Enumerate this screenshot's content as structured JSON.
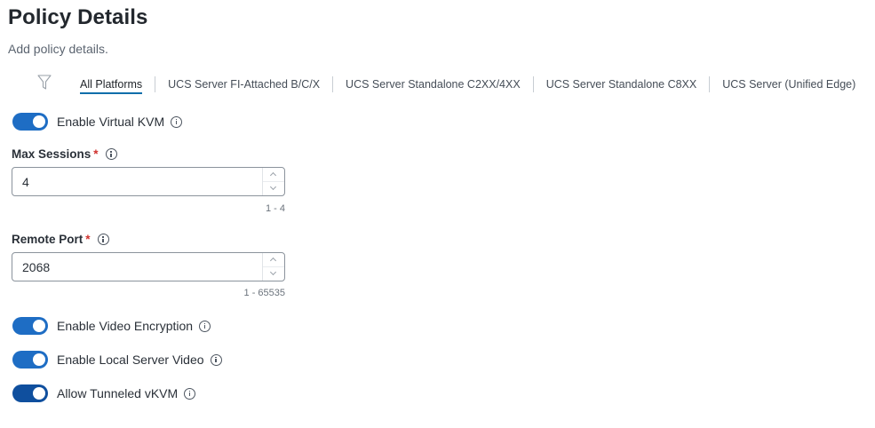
{
  "page": {
    "title": "Policy Details",
    "subtitle": "Add policy details."
  },
  "platform_tabs": [
    {
      "label": "All Platforms",
      "active": true
    },
    {
      "label": "UCS Server FI-Attached B/C/X",
      "active": false
    },
    {
      "label": "UCS Server Standalone C2XX/4XX",
      "active": false
    },
    {
      "label": "UCS Server Standalone C8XX",
      "active": false
    },
    {
      "label": "UCS Server (Unified Edge)",
      "active": false
    }
  ],
  "enable_virtual_kvm": {
    "label": "Enable Virtual KVM",
    "on": true
  },
  "max_sessions": {
    "label": "Max Sessions",
    "required_mark": "*",
    "value": "4",
    "range": "1 - 4"
  },
  "remote_port": {
    "label": "Remote Port",
    "required_mark": "*",
    "value": "2068",
    "range": "1 - 65535"
  },
  "enable_video_encryption": {
    "label": "Enable Video Encryption",
    "on": true
  },
  "enable_local_server_video": {
    "label": "Enable Local Server Video",
    "on": true
  },
  "allow_tunneled_vkvm": {
    "label": "Allow Tunneled vKVM",
    "on": true
  },
  "colors": {
    "toggle_on": "#1e6dc4",
    "toggle_on_dark": "#0f4f9e",
    "tab_underline": "#0d6eaa",
    "required": "#d0312d"
  },
  "icons": {
    "filter": "filter-funnel-icon",
    "info": "info-circle-icon"
  }
}
